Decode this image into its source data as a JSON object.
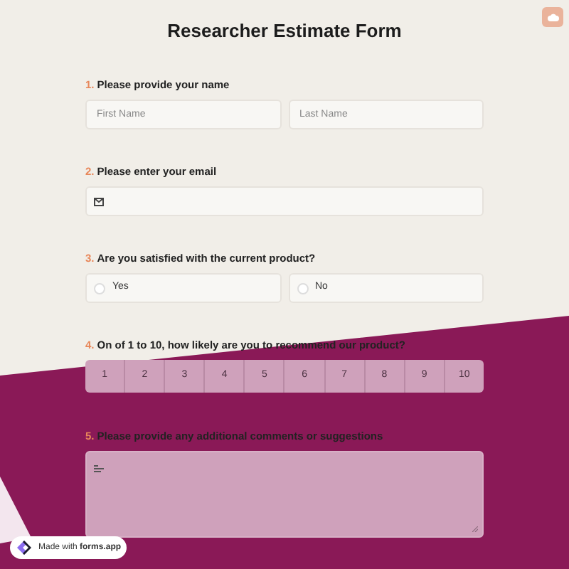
{
  "title": "Researcher Estimate Form",
  "questions": [
    {
      "kind": "name",
      "number": "1.",
      "label": "Please provide your name",
      "fields": [
        {
          "placeholder": "First Name"
        },
        {
          "placeholder": "Last Name"
        }
      ]
    },
    {
      "kind": "email",
      "number": "2.",
      "label": "Please enter your email"
    },
    {
      "kind": "choice",
      "number": "3.",
      "label": "Are you satisfied with the current product?",
      "options": [
        {
          "label": "Yes",
          "selected": false
        },
        {
          "label": "No",
          "selected": false
        }
      ]
    },
    {
      "kind": "scale",
      "number": "4.",
      "label": "On of 1 to 10, how likely are you to recommend our product?",
      "options": [
        "1",
        "2",
        "3",
        "4",
        "5",
        "6",
        "7",
        "8",
        "9",
        "10"
      ]
    },
    {
      "kind": "textarea",
      "number": "5.",
      "label": "Please provide any additional comments or suggestions"
    }
  ],
  "badge": "Made with **forms.app**"
}
